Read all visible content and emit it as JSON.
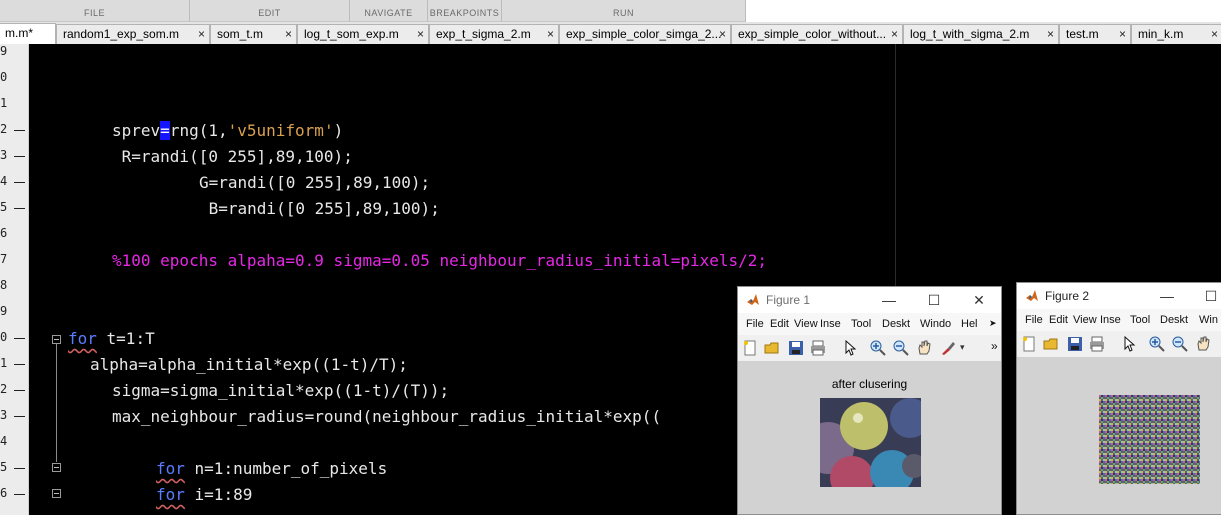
{
  "toolstrip": {
    "sections": [
      "FILE",
      "EDIT",
      "NAVIGATE",
      "BREAKPOINTS",
      "RUN"
    ]
  },
  "tabs": [
    {
      "label": "m.m*",
      "active": true
    },
    {
      "label": "random1_exp_som.m"
    },
    {
      "label": "som_t.m"
    },
    {
      "label": "log_t_som_exp.m"
    },
    {
      "label": "exp_t_sigma_2.m"
    },
    {
      "label": "exp_simple_color_simga_2..."
    },
    {
      "label": "exp_simple_color_without..."
    },
    {
      "label": "log_t_with_sigma_2.m"
    },
    {
      "label": "test.m"
    },
    {
      "label": "min_k.m"
    }
  ],
  "tab_close_glyph": "×",
  "gutter": {
    "line_numbers": [
      "9",
      "0",
      "1",
      "2",
      "3",
      "4",
      "5",
      "6",
      "7",
      "8",
      "9",
      "0",
      "1",
      "2",
      "3",
      "4",
      "5",
      "6"
    ]
  },
  "code": {
    "l12_a": "sprev",
    "l12_cursor": "=",
    "l12_b": "rng(1,",
    "l12_str": "'v5uniform'",
    "l12_c": ")",
    "l13": " R=randi([0 255],89,100);",
    "l14": "G=randi([0 255],89,100);",
    "l15": " B=randi([0 255],89,100);",
    "l17": "%100 epochs alpaha=0.9 sigma=0.05 neighbour_radius_initial=pixels/2;",
    "l20_kw": "for",
    "l20": " t=1:T",
    "l21": "alpha=alpha_initial*exp((1-t)/T);",
    "l22": "sigma=sigma_initial*exp((1-t)/(T));",
    "l23": "max_neighbour_radius=round(neighbour_radius_initial*exp((",
    "l25_kw": "for",
    "l25": " n=1:number_of_pixels",
    "l26_kw": "for",
    "l26": " i=1:89"
  },
  "figure1": {
    "title": "Figure 1",
    "menus": [
      "File",
      "Edit",
      "View",
      "Inse",
      "Tool",
      "Deskt",
      "Windo",
      "Hel"
    ],
    "plot_title": "after clusering"
  },
  "figure2": {
    "title": "Figure 2",
    "menus": [
      "File",
      "Edit",
      "View",
      "Inse",
      "Tool",
      "Deskt",
      "Win"
    ]
  },
  "colors": {
    "keyword": "#5a7cff",
    "string": "#d9a050",
    "comment": "#e628e6",
    "editor_bg": "#000000"
  }
}
